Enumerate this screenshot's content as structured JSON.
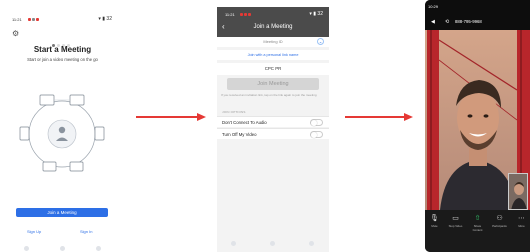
{
  "screen1": {
    "status_time": "11:21",
    "status_right": "▾ ▮ 32",
    "title": "Start a Meeting",
    "subtitle": "Start or join a video meeting on the go",
    "join_button": "Join a Meeting",
    "sign_up": "Sign Up",
    "sign_in": "Sign In"
  },
  "screen2": {
    "status_time": "11:21",
    "status_right": "▾ ▮ 32",
    "back_label": "‹",
    "title": "Join a Meeting",
    "meeting_id_placeholder": "Meeting ID",
    "personal_link": "Join with a personal link name",
    "name": "CPC PR",
    "join_button": "Join Meeting",
    "note": "If you received an invitation link, tap on the link again to join the meeting",
    "section_label": "JOIN OPTIONS",
    "option1": "Don't Connect To Audio",
    "option2": "Turn Off My Video"
  },
  "screen3": {
    "status_time": "10:29",
    "top_title": "888-795-9968",
    "controls": [
      {
        "label": "Mute",
        "icon": "microphone-icon"
      },
      {
        "label": "Stop Video",
        "icon": "video-camera-icon"
      },
      {
        "label": "Share Content",
        "icon": "share-icon"
      },
      {
        "label": "Participants",
        "icon": "participants-icon"
      },
      {
        "label": "More",
        "icon": "more-icon"
      }
    ]
  },
  "colors": {
    "accent_blue": "#2d6fe6",
    "arrow_red": "#e53935",
    "header_gray": "#4b4b4b"
  }
}
